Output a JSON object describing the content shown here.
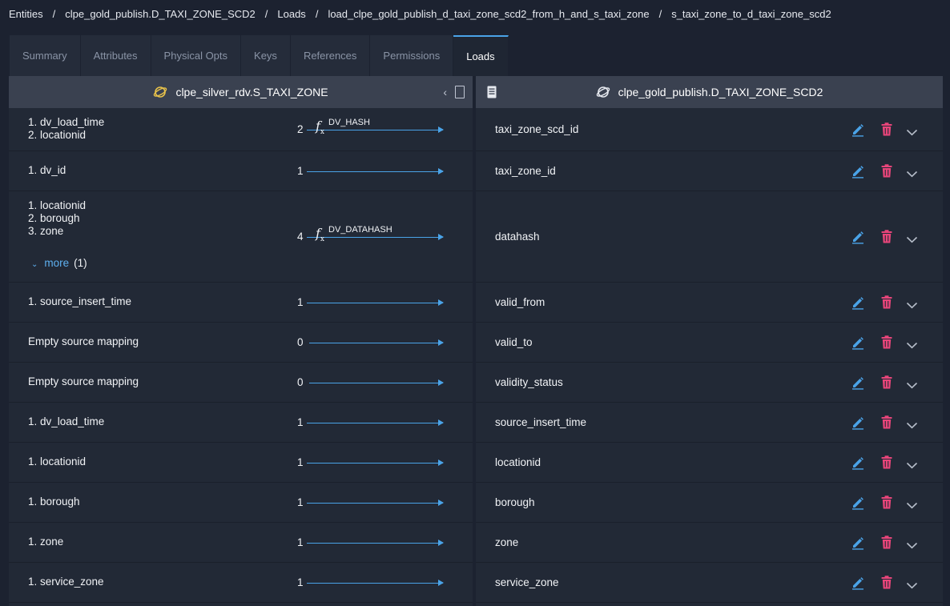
{
  "breadcrumb": [
    "Entities",
    "clpe_gold_publish.D_TAXI_ZONE_SCD2",
    "Loads",
    "load_clpe_gold_publish_d_taxi_zone_scd2_from_h_and_s_taxi_zone",
    "s_taxi_zone_to_d_taxi_zone_scd2"
  ],
  "tabs": [
    "Summary",
    "Attributes",
    "Physical Opts",
    "Keys",
    "References",
    "Permissions",
    "Loads"
  ],
  "active_tab": "Loads",
  "source_panel": {
    "title": "clpe_silver_rdv.S_TAXI_ZONE"
  },
  "target_panel": {
    "title": "clpe_gold_publish.D_TAXI_ZONE_SCD2"
  },
  "more_link": {
    "label": "more",
    "count": "(1)"
  },
  "colors": {
    "accent": "#4aa3e8",
    "delete": "#e8457a",
    "background": "#1c2230"
  },
  "rows": [
    {
      "sources": [
        "1. dv_load_time",
        "2. locationid"
      ],
      "count": "2",
      "function": "DV_HASH",
      "target": "taxi_zone_scd_id"
    },
    {
      "sources": [
        "1. dv_id"
      ],
      "count": "1",
      "function": "",
      "target": "taxi_zone_id"
    },
    {
      "sources": [
        "1. locationid",
        "2. borough",
        "3. zone"
      ],
      "count": "4",
      "function": "DV_DATAHASH",
      "target": "datahash",
      "has_more": true
    },
    {
      "sources": [
        "1. source_insert_time"
      ],
      "count": "1",
      "function": "",
      "target": "valid_from"
    },
    {
      "sources": [
        "Empty source mapping"
      ],
      "count": "0",
      "function": "",
      "target": "valid_to"
    },
    {
      "sources": [
        "Empty source mapping"
      ],
      "count": "0",
      "function": "",
      "target": "validity_status"
    },
    {
      "sources": [
        "1. dv_load_time"
      ],
      "count": "1",
      "function": "",
      "target": "source_insert_time"
    },
    {
      "sources": [
        "1. locationid"
      ],
      "count": "1",
      "function": "",
      "target": "locationid"
    },
    {
      "sources": [
        "1. borough"
      ],
      "count": "1",
      "function": "",
      "target": "borough"
    },
    {
      "sources": [
        "1. zone"
      ],
      "count": "1",
      "function": "",
      "target": "zone"
    },
    {
      "sources": [
        "1. service_zone"
      ],
      "count": "1",
      "function": "",
      "target": "service_zone"
    }
  ]
}
